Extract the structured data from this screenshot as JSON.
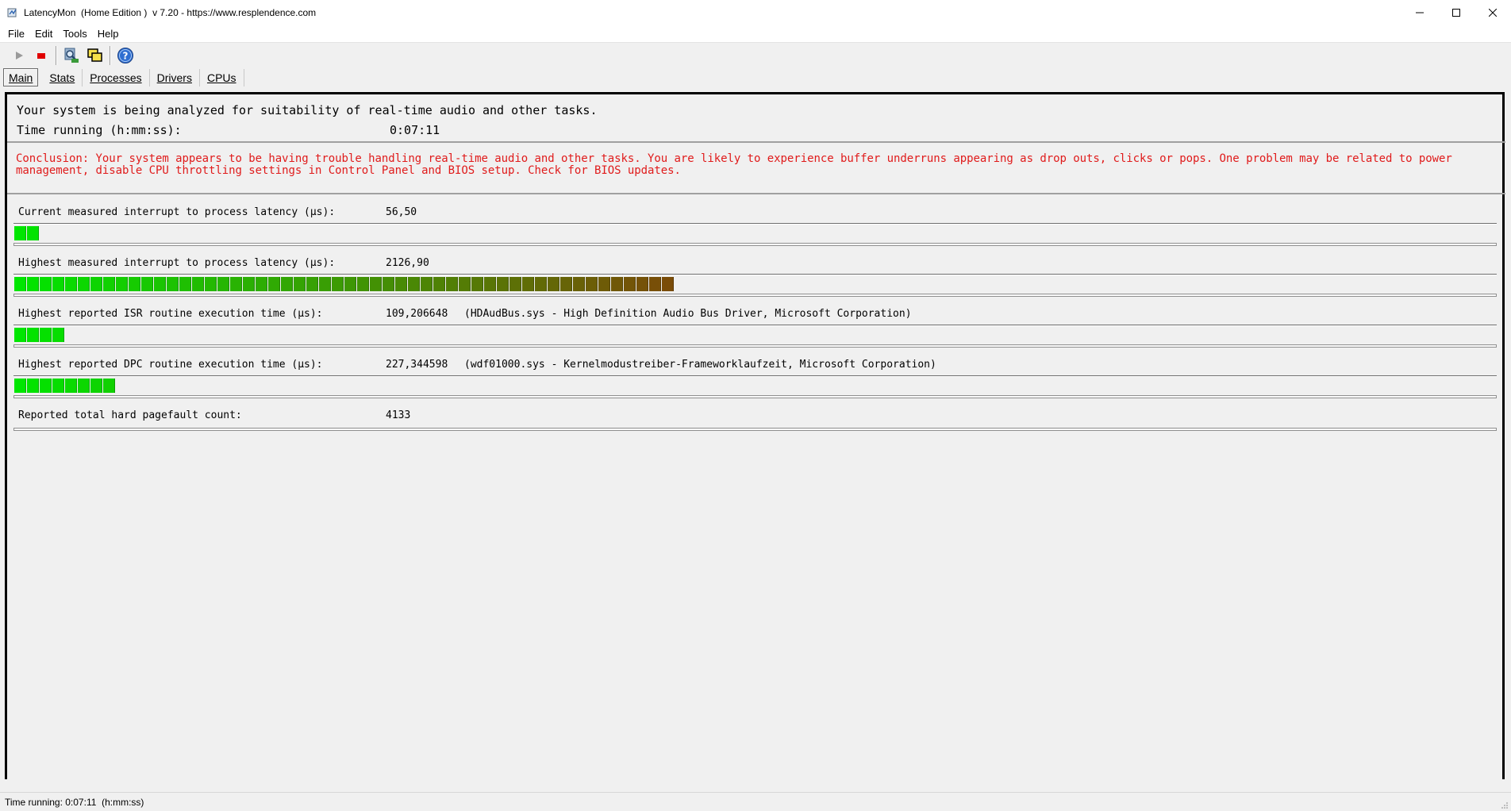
{
  "window": {
    "title": "LatencyMon  (Home Edition )  v 7.20 - https://www.resplendence.com",
    "icon": "latencymon-app-icon",
    "controls": {
      "minimize": "–",
      "maximize": "☐",
      "close": "✕"
    }
  },
  "menu": {
    "items": [
      {
        "label": "File",
        "accel": "F"
      },
      {
        "label": "Edit",
        "accel": "E"
      },
      {
        "label": "Tools",
        "accel": "T"
      },
      {
        "label": "Help",
        "accel": "H"
      }
    ]
  },
  "toolbar": {
    "buttons": [
      {
        "name": "play-icon"
      },
      {
        "name": "stop-icon"
      },
      {
        "name": "analyze-icon"
      },
      {
        "name": "windows-icon"
      },
      {
        "name": "help-icon"
      }
    ]
  },
  "tabs": [
    {
      "label": "Main",
      "active": true
    },
    {
      "label": "Stats",
      "active": false
    },
    {
      "label": "Processes",
      "active": false
    },
    {
      "label": "Drivers",
      "active": false
    },
    {
      "label": "CPUs",
      "active": false
    }
  ],
  "main": {
    "status_line": "Your system is being analyzed for suitability of real-time audio and other tasks.",
    "time_label": "Time running (h:mm:ss):",
    "time_value": "0:07:11",
    "conclusion": "Conclusion: Your system appears to be having trouble handling real-time audio and other tasks. You are likely to experience buffer underruns appearing as drop outs, clicks or pops. One problem may be related to power management, disable CPU throttling settings in Control Panel and BIOS setup. Check for BIOS updates.",
    "conclusion_color": "#e01b1b",
    "metrics": [
      {
        "label": "Current measured interrupt to process latency (µs):",
        "value": "56,50",
        "detail": "",
        "segments": 2
      },
      {
        "label": "Highest measured interrupt to process latency (µs):",
        "value": "2126,90",
        "detail": "",
        "segments": 52
      },
      {
        "label": "Highest reported ISR routine execution time (µs):",
        "value": "109,206648",
        "detail": "(HDAudBus.sys - High Definition Audio Bus Driver, Microsoft Corporation)",
        "segments": 4
      },
      {
        "label": "Highest reported DPC routine execution time (µs):",
        "value": "227,344598",
        "detail": "(wdf01000.sys - Kernelmodustreiber-Frameworklaufzeit, Microsoft Corporation)",
        "segments": 8
      },
      {
        "label": "Reported total hard pagefault count:",
        "value": "4133",
        "detail": ""
      }
    ]
  },
  "statusbar": {
    "text": "Time running: 0:07:11  (h:mm:ss)"
  }
}
